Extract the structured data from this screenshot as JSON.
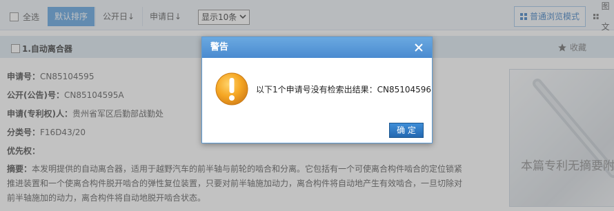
{
  "toolbar": {
    "select_all": "全选",
    "sort_default": "默认排序",
    "sort_pub_date": "公开日",
    "sort_app_date": "申请日",
    "page_size": "显示10条",
    "view_normal": "普通浏览模式",
    "view_image": "图文"
  },
  "result": {
    "title": "1.自动离合器",
    "favorite": "收藏",
    "fields": [
      {
        "label": "申请号：",
        "value": "CN85104595"
      },
      {
        "label": "公开(公告)号：",
        "value": "CN85104595A"
      },
      {
        "label": "申请(专利权)人：",
        "value": "贵州省军区后勤部战勤处"
      },
      {
        "label": "分类号：",
        "value": "F16D43/20"
      },
      {
        "label": "优先权：",
        "value": ""
      }
    ],
    "abstract_label": "摘要：",
    "abstract_text": "本发明提供的自动离合器，适用于越野汽车的前半轴与前轮的啮合和分离。它包括有一个可使离合构件啮合的定位锁紧推进装置和一个使离合构件脱开啮合的弹性复位装置，只要对前半轴施加动力，离合构件将自动地产生有效啮合，一旦切除对前半轴施加的动力，离合构件将自动地脱开啮合状态。",
    "thumb_text": "本篇专利无摘要附"
  },
  "dialog": {
    "title": "警告",
    "message": "以下1个申请号没有检索出结果：CN85104596",
    "ok_label": "确 定"
  },
  "colors": {
    "accent": "#5aa0e0",
    "dialog_header": "#4a8bd0",
    "warning_icon": "#f0a020"
  }
}
